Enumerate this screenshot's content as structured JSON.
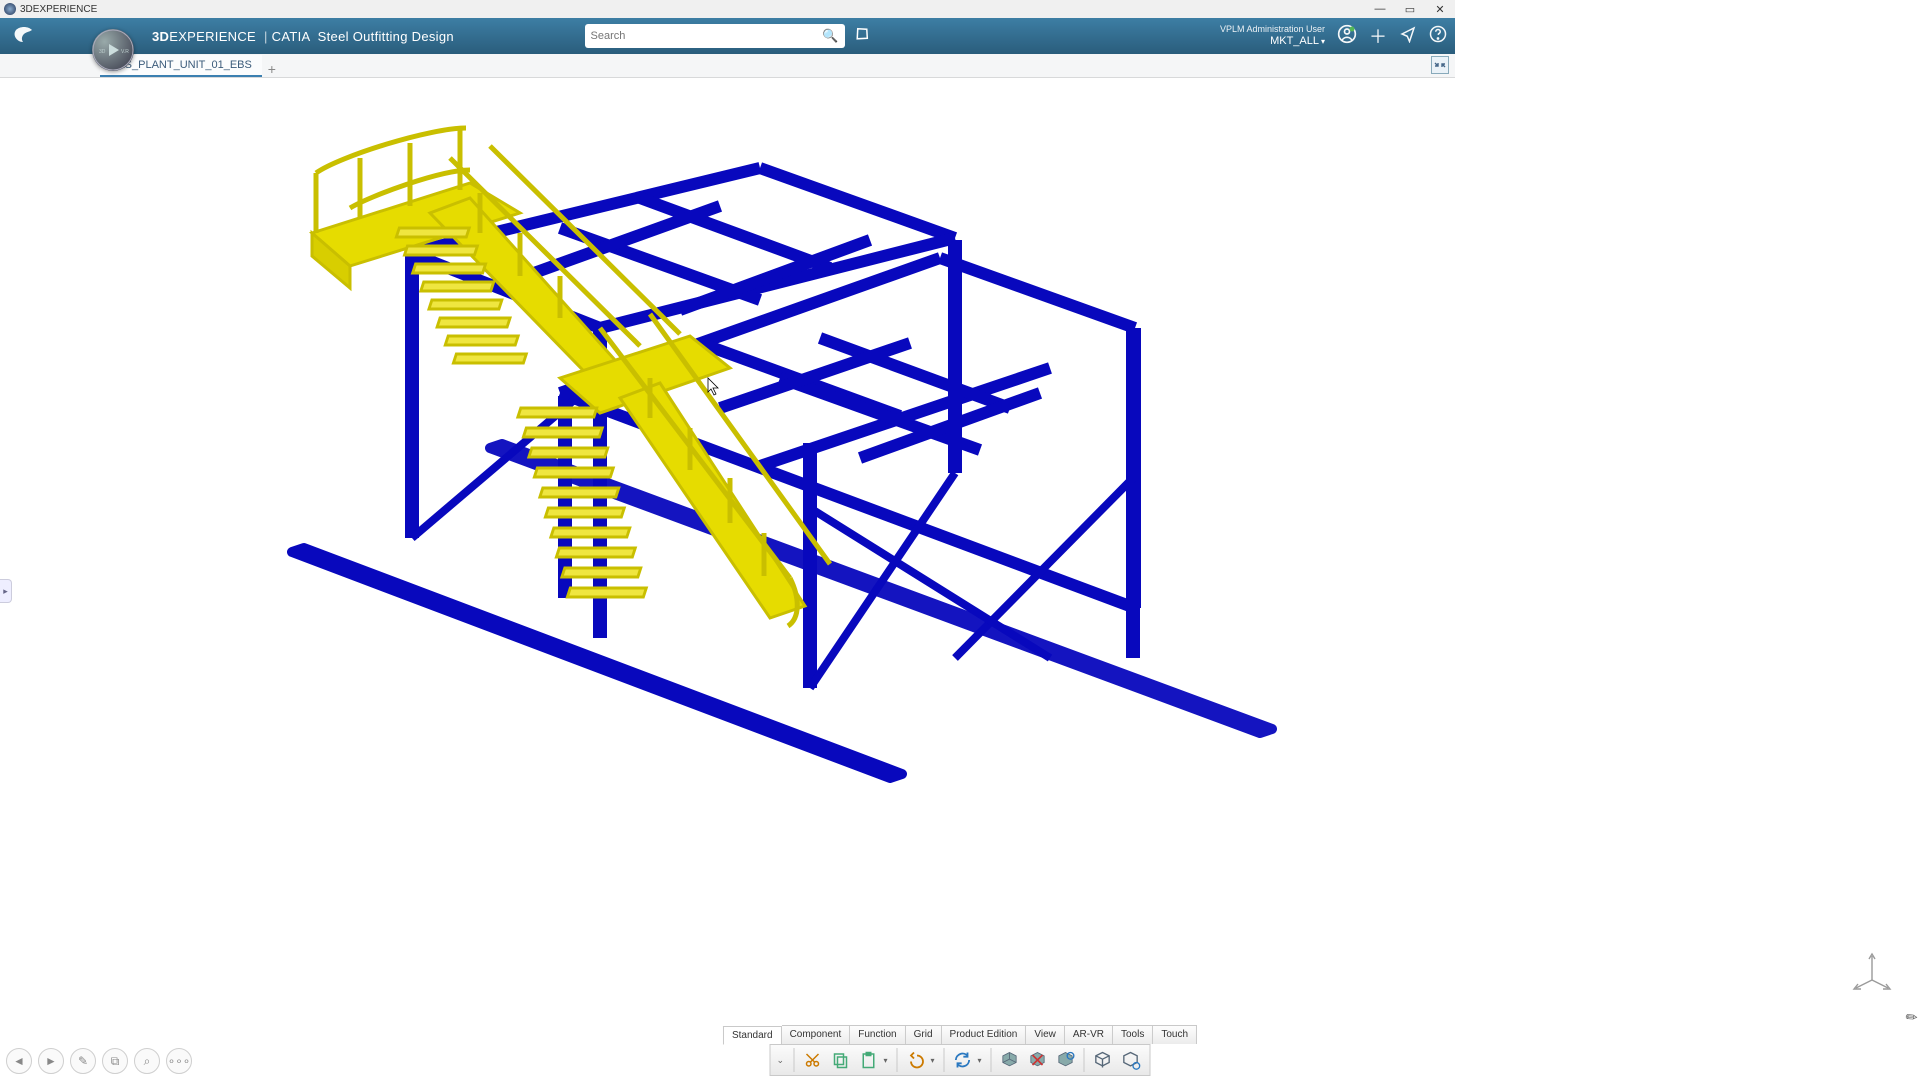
{
  "window": {
    "title": "3DEXPERIENCE"
  },
  "header": {
    "brand_prefix_bold": "3D",
    "brand_prefix_rest": "EXPERIENCE",
    "brand_separator": "|",
    "brand_product": "CATIA",
    "brand_app": "Steel Outfitting Design",
    "search_placeholder": "Search",
    "user_line1": "VPLM Administration User",
    "user_line2": "MKT_ALL"
  },
  "tabs": {
    "active": "EAS_PLANT_UNIT_01_EBS"
  },
  "ribbon": {
    "tabs": [
      "Standard",
      "Component",
      "Function",
      "Grid",
      "Product Edition",
      "View",
      "AR-VR",
      "Tools",
      "Touch"
    ],
    "active_index": 0,
    "buttons": [
      "cut",
      "copy",
      "paste",
      "undo",
      "update",
      "assembly",
      "remove-assembly",
      "view-cube",
      "box",
      "link-box"
    ]
  },
  "nav_buttons": [
    "back",
    "forward",
    "edit",
    "copy-view",
    "zoom",
    "more"
  ],
  "colors": {
    "steel": "#0808bd",
    "stair": "#e6dc00",
    "header": "#2f6a8e"
  }
}
